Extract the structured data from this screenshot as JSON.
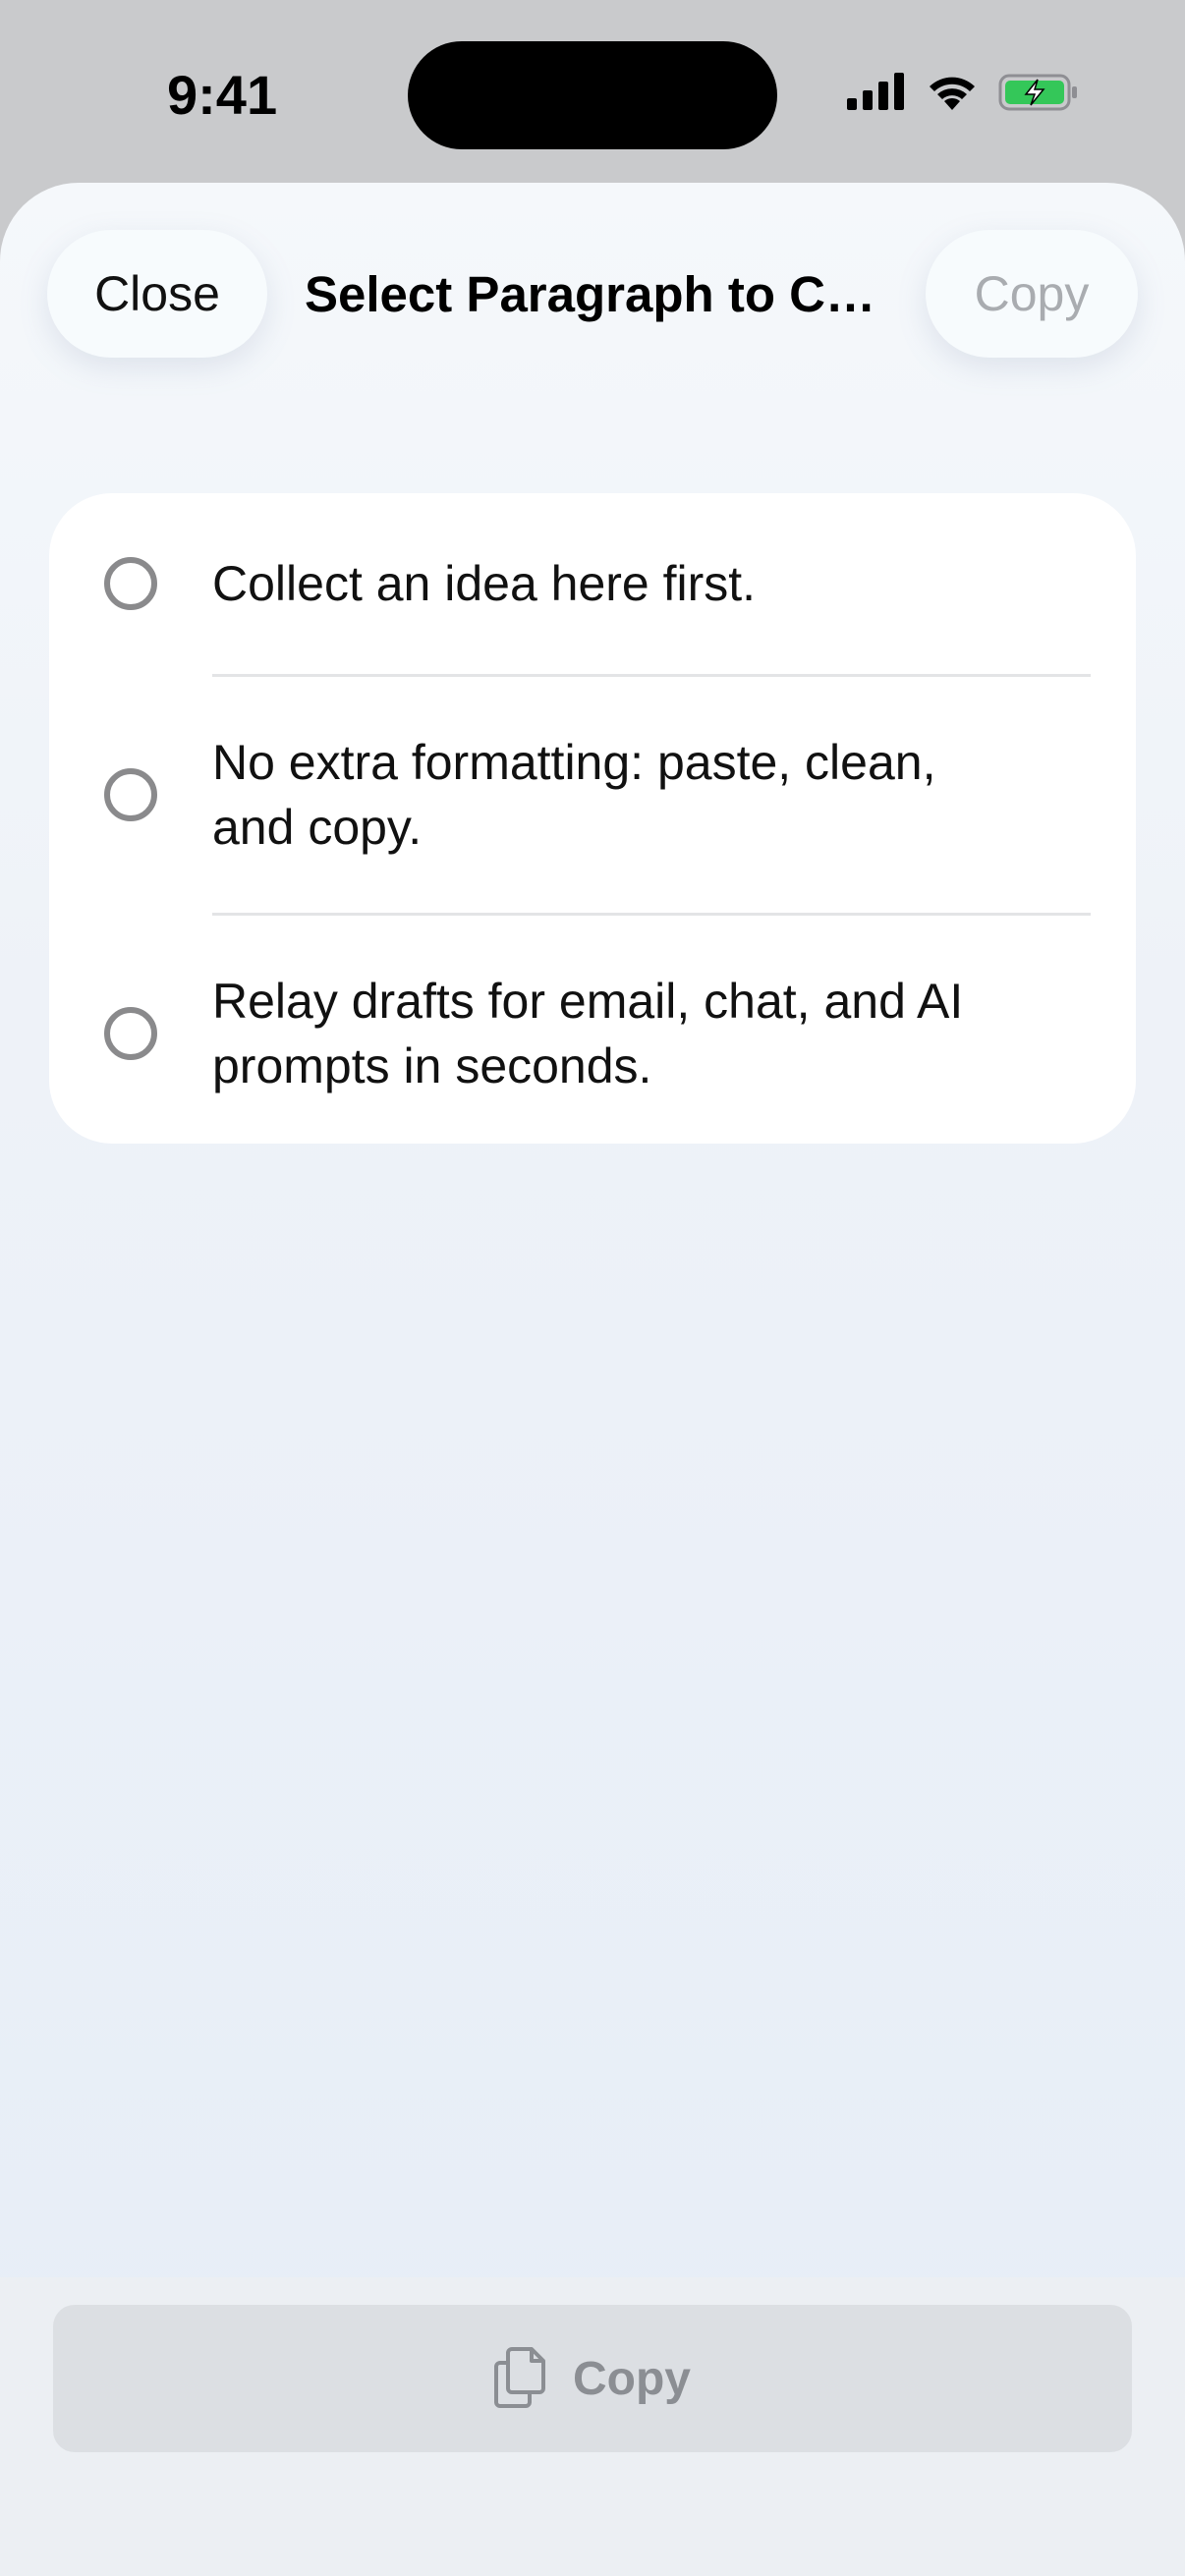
{
  "status_bar": {
    "time": "9:41",
    "icons": [
      "cellular-signal-icon",
      "wifi-icon",
      "battery-charging-icon"
    ],
    "battery_color": "#34c759"
  },
  "header": {
    "close_label": "Close",
    "title": "Select Paragraph to Co...",
    "copy_label": "Copy"
  },
  "paragraphs": [
    {
      "text": "Collect an idea here first.",
      "selected": false
    },
    {
      "text": "No extra formatting: paste, clean, and copy.",
      "selected": false
    },
    {
      "text": "Relay drafts for email, chat, and AI prompts in seconds.",
      "selected": false
    }
  ],
  "bottom_bar": {
    "copy_label": "Copy",
    "icon": "documents-copy-icon"
  }
}
